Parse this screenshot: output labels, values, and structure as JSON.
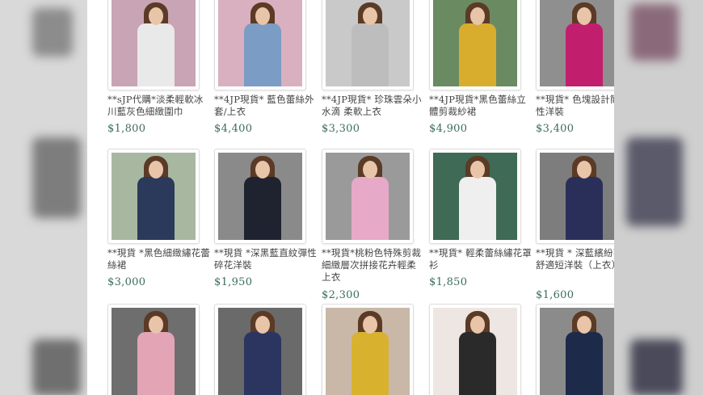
{
  "products": [
    {
      "title": "**sJP代購*淡柔輕軟冰川藍灰色細緻圍巾",
      "price": "$1,800",
      "bg": "#c8a4b4",
      "body": "#e9e9e9"
    },
    {
      "title": "**4JP現貨* 藍色蕾絲外套/上衣",
      "price": "$4,400",
      "bg": "#d9b0c0",
      "body": "#7b9cc4"
    },
    {
      "title": "**4JP現貨* 珍珠雲朵小水滴 柔軟上衣",
      "price": "$3,300",
      "bg": "#c9c9c9",
      "body": "#bdbdbd"
    },
    {
      "title": "**4JP現貨*黑色蕾絲立體剪裁紗裙",
      "price": "$4,900",
      "bg": "#6a8a62",
      "body": "#d8ad2e"
    },
    {
      "title": "**現貨* 色塊設計簡約彈性洋裝",
      "price": "$3,400",
      "bg": "#8f8f8f",
      "body": "#c21e6e"
    },
    {
      "title": "**現貨 *黑色細緻繡花蕾絲裙",
      "price": "$3,000",
      "bg": "#a8b8a0",
      "body": "#2b3a5a"
    },
    {
      "title": "**現貨 *深黑藍直紋彈性碎花洋裝",
      "price": "$1,950",
      "bg": "#8a8a8a",
      "body": "#1f2330"
    },
    {
      "title": "**現貨*桃粉色特殊剪裁細緻層次拼接花卉輕柔上衣",
      "price": "$2,300",
      "bg": "#9a9a9a",
      "body": "#e7a9c8"
    },
    {
      "title": "**現貨* 輕柔蕾絲繡花罩衫",
      "price": "$1,850",
      "bg": "#3f6a55",
      "body": "#efefef"
    },
    {
      "title": "**現貨 * 深藍繽紛花朵舒適短洋裝（上衣）",
      "price": "$1,600",
      "bg": "#7d7d7d",
      "body": "#2a2f5a"
    },
    {
      "title": "",
      "price": "",
      "bg": "#6e6e6e",
      "body": "#e3a5b6"
    },
    {
      "title": "",
      "price": "",
      "bg": "#6a6a6a",
      "body": "#2b3560"
    },
    {
      "title": "",
      "price": "",
      "bg": "#c9b8a8",
      "body": "#d8b22e"
    },
    {
      "title": "",
      "price": "",
      "bg": "#ede6e2",
      "body": "#2a2a2a"
    },
    {
      "title": "",
      "price": "",
      "bg": "#8b8b8b",
      "body": "#1e2a4a"
    }
  ]
}
